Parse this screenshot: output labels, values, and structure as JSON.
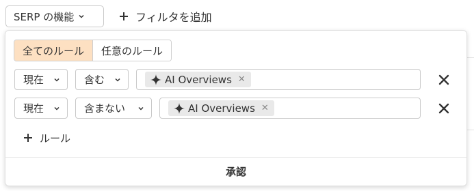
{
  "toolbar": {
    "serp_label": "SERP の機能",
    "add_filter_label": "フィルタを追加"
  },
  "panel": {
    "match_options": [
      {
        "label": "全てのルール",
        "active": true
      },
      {
        "label": "任意のルール",
        "active": false
      }
    ],
    "rules": [
      {
        "field": "現在",
        "operator": "含む",
        "value": "AI Overviews"
      },
      {
        "field": "現在",
        "operator": "含まない",
        "value": "AI Overviews"
      }
    ],
    "add_rule_label": "ルール",
    "approve_label": "承認"
  },
  "colors": {
    "active_segment": "#fde0c2",
    "chip_background": "#e9e9e9",
    "border": "#c9c9c9"
  },
  "icons": [
    "chevron-down-icon",
    "plus-icon",
    "sparkle-icon",
    "close-icon"
  ]
}
